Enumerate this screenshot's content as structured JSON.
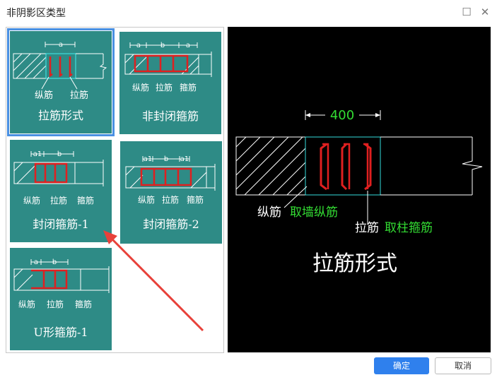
{
  "window": {
    "title": "非阴影区类型"
  },
  "cards": [
    {
      "label": "拉筋形式",
      "selected": true,
      "dim_labels": [
        "a"
      ],
      "part_labels": [
        "纵筋",
        "拉筋"
      ]
    },
    {
      "label": "非封闭箍筋",
      "selected": false,
      "dim_labels": [
        "a",
        "b",
        "a"
      ],
      "part_labels": [
        "纵筋",
        "拉筋",
        "箍筋"
      ]
    },
    {
      "label": "封闭箍筋-1",
      "selected": false,
      "dim_labels": [
        "a1",
        "b"
      ],
      "part_labels": [
        "纵筋",
        "拉筋",
        "箍筋"
      ]
    },
    {
      "label": "封闭箍筋-2",
      "selected": false,
      "dim_labels": [
        "a1",
        "b",
        "a1"
      ],
      "part_labels": [
        "纵筋",
        "拉筋",
        "箍筋"
      ]
    },
    {
      "label": "U形箍筋-1",
      "selected": false,
      "dim_labels": [
        "a",
        "b"
      ],
      "part_labels": [
        "纵筋",
        "拉筋",
        "箍筋"
      ]
    }
  ],
  "preview": {
    "dimension": "400",
    "label_a_white": "纵筋",
    "label_a_green": "取墙纵筋",
    "label_b_white": "拉筋",
    "label_b_green": "取柱箍筋",
    "title": "拉筋形式"
  },
  "buttons": {
    "ok": "确定",
    "cancel": "取消"
  }
}
